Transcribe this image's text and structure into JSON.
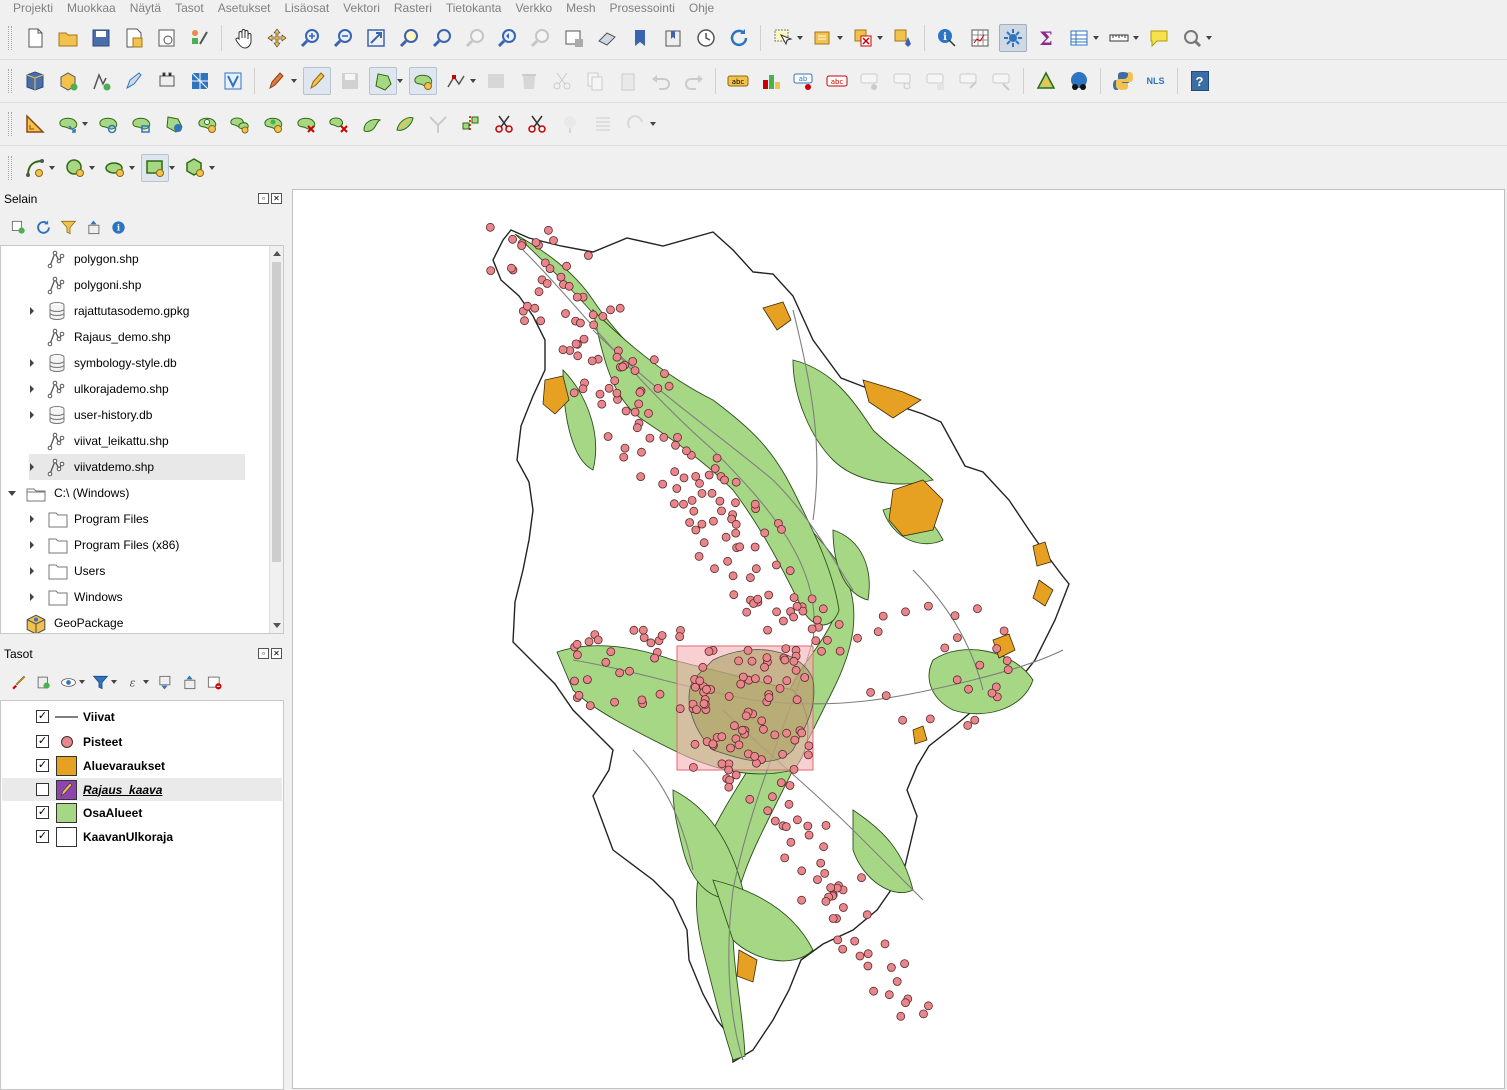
{
  "menu": [
    "Projekti",
    "Muokkaa",
    "Näytä",
    "Tasot",
    "Asetukset",
    "Lisäosat",
    "Vektori",
    "Rasteri",
    "Tietokanta",
    "Verkko",
    "Mesh",
    "Prosessointi",
    "Ohje"
  ],
  "toolbar_nls_label": "NLS",
  "toolbar_help_label": "?",
  "browser_panel": {
    "title": "Selain",
    "items": [
      {
        "label": "polygon.shp",
        "icon": "vector-file-icon",
        "expander": "none",
        "level": 2
      },
      {
        "label": "polygoni.shp",
        "icon": "vector-file-icon",
        "expander": "none",
        "level": 2
      },
      {
        "label": "rajattutasodemo.gpkg",
        "icon": "database-icon",
        "expander": "right",
        "level": 2
      },
      {
        "label": "Rajaus_demo.shp",
        "icon": "vector-file-icon",
        "expander": "none",
        "level": 2
      },
      {
        "label": "symbology-style.db",
        "icon": "database-icon",
        "expander": "right",
        "level": 2
      },
      {
        "label": "ulkorajademo.shp",
        "icon": "vector-file-icon",
        "expander": "right",
        "level": 2
      },
      {
        "label": "user-history.db",
        "icon": "database-icon",
        "expander": "right",
        "level": 2
      },
      {
        "label": "viivat_leikattu.shp",
        "icon": "vector-file-icon",
        "expander": "none",
        "level": 2
      },
      {
        "label": "viivatdemo.shp",
        "icon": "vector-file-icon",
        "expander": "right",
        "level": 2,
        "selected": true
      },
      {
        "label": "C:\\ (Windows)",
        "icon": "drive-icon",
        "expander": "down",
        "level": 1
      },
      {
        "label": "Program Files",
        "icon": "folder-icon",
        "expander": "right",
        "level": 2
      },
      {
        "label": "Program Files (x86)",
        "icon": "folder-icon",
        "expander": "right",
        "level": 2
      },
      {
        "label": "Users",
        "icon": "folder-icon",
        "expander": "right",
        "level": 2
      },
      {
        "label": "Windows",
        "icon": "folder-icon",
        "expander": "right",
        "level": 2
      },
      {
        "label": "GeoPackage",
        "icon": "geopackage-icon",
        "expander": "none",
        "level": 1
      }
    ]
  },
  "layers_panel": {
    "title": "Tasot",
    "layers": [
      {
        "name": "Viivat",
        "checked": true,
        "symbol": "line",
        "color": "#7f7f7f"
      },
      {
        "name": "Pisteet",
        "checked": true,
        "symbol": "point",
        "color": "#e8868b"
      },
      {
        "name": "Aluevaraukset",
        "checked": true,
        "symbol": "fill",
        "color": "#e6a122"
      },
      {
        "name": "Rajaus_kaava",
        "checked": false,
        "symbol": "edit",
        "color": "#8e44ad",
        "italic": true
      },
      {
        "name": "OsaAlueet",
        "checked": true,
        "symbol": "fill",
        "color": "#a6d785"
      },
      {
        "name": "KaavanUlkoraja",
        "checked": true,
        "symbol": "fill",
        "color": "#ffffff"
      }
    ]
  },
  "map_colors": {
    "boundary_fill": "#ffffff",
    "subarea_fill": "#a6d785",
    "reservation_fill": "#e6a122",
    "points_fill": "#e8868b",
    "lines_stroke": "#7f7f7f",
    "selection_fill": "#f4b0b4"
  }
}
